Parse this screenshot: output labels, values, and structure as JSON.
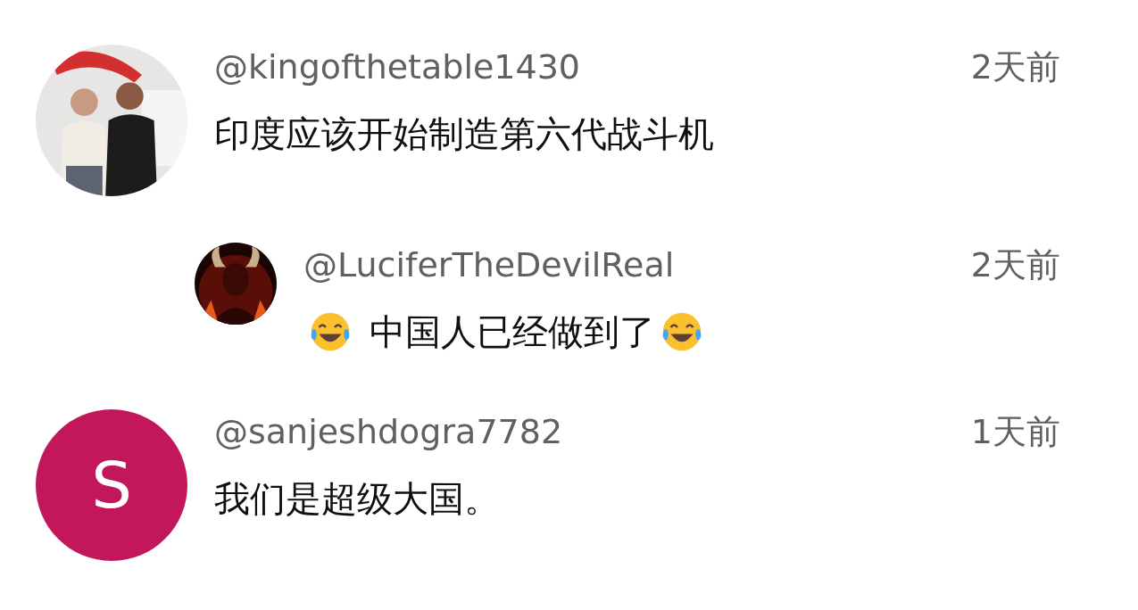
{
  "comments": [
    {
      "avatar": {
        "kind": "picture"
      },
      "username": "@kingofthetable1430",
      "time": "2天前",
      "text": "印度应该开始制造第六代战斗机",
      "replies": [
        {
          "avatar": {
            "kind": "picture"
          },
          "username": "@LuciferTheDevilReal",
          "time": "2天前",
          "text": "中国人已经做到了",
          "emoji_before": true,
          "emoji_after": true
        }
      ]
    },
    {
      "avatar": {
        "kind": "letter",
        "letter": "S",
        "color": "#c2185b"
      },
      "username": "@sanjeshdogra7782",
      "time": "1天前",
      "text": "我们是超级大国。"
    }
  ]
}
